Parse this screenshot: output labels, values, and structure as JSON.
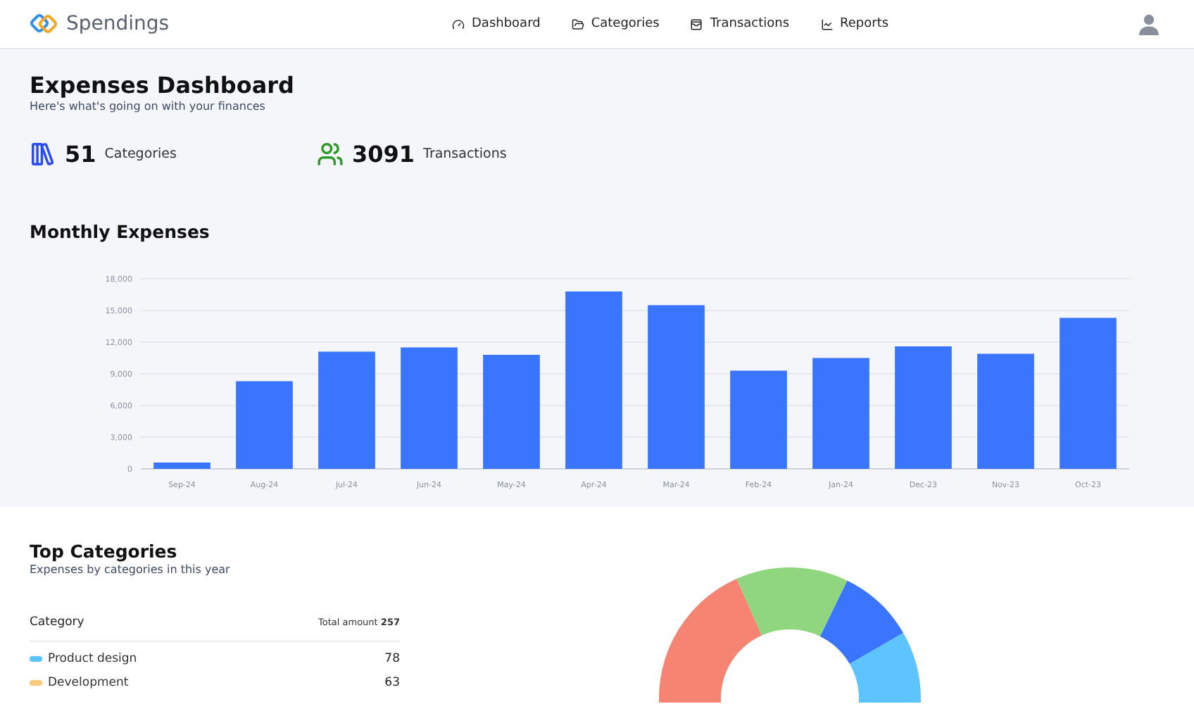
{
  "brand": "Spendings",
  "nav": [
    {
      "label": "Dashboard"
    },
    {
      "label": "Categories"
    },
    {
      "label": "Transactions"
    },
    {
      "label": "Reports"
    }
  ],
  "title": "Expenses Dashboard",
  "subtitle": "Here's what's going on with your finances",
  "stats": [
    {
      "value": "51",
      "label": "Categories",
      "color": "#2b4cf5"
    },
    {
      "value": "3091",
      "label": "Transactions",
      "color": "#2e9a28"
    }
  ],
  "monthly": {
    "title": "Monthly Expenses",
    "chart_data": {
      "type": "bar",
      "categories": [
        "Sep-24",
        "Aug-24",
        "Jul-24",
        "Jun-24",
        "May-24",
        "Apr-24",
        "Mar-24",
        "Feb-24",
        "Jan-24",
        "Dec-23",
        "Nov-23",
        "Oct-23"
      ],
      "grid": true,
      "series": [
        {
          "color": "#3a75ff",
          "values": [
            600,
            8300,
            11100,
            11500,
            10800,
            16800,
            15500,
            9300,
            10500,
            11600,
            10900,
            14300
          ]
        }
      ],
      "ylim": [
        0,
        18000
      ],
      "yticks": [
        {
          "value": 0,
          "label": "0"
        },
        {
          "value": 3000,
          "label": "3,000"
        },
        {
          "value": 6000,
          "label": "6,000"
        },
        {
          "value": 9000,
          "label": "9,000"
        },
        {
          "value": 12000,
          "label": "12,000"
        },
        {
          "value": 15000,
          "label": "15,000"
        },
        {
          "value": 18000,
          "label": "18,000"
        }
      ]
    }
  },
  "top": {
    "title": "Top Categories",
    "subtitle": "Expenses by categories in this year",
    "column_header": "Category",
    "total_label": "Total amount",
    "total": "257",
    "rows": [
      {
        "name": "Product design",
        "amount": "78",
        "color": "#5ec4ff"
      },
      {
        "name": "Development",
        "amount": "63",
        "color": "#ffc97a"
      }
    ]
  }
}
